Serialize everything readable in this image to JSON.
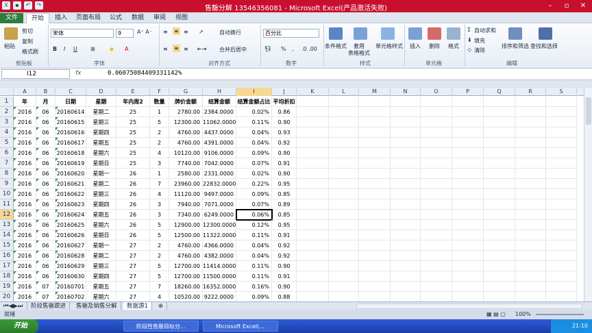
{
  "window": {
    "title": "售罄分解 13546356081 - Microsoft Excel(产品激活失败)"
  },
  "tabs": [
    "文件",
    "开始",
    "插入",
    "页面布局",
    "公式",
    "数据",
    "审阅",
    "视图"
  ],
  "ribbon": {
    "clipboard": {
      "paste": "粘贴",
      "cut": "剪切",
      "copy": "复制",
      "format_painter": "格式刷",
      "label": "剪贴板"
    },
    "font": {
      "name": "宋体",
      "size": "9",
      "label": "字体"
    },
    "alignment": {
      "wrap": "自动换行",
      "merge": "合并后居中",
      "label": "对齐方式"
    },
    "number": {
      "format": "百分比",
      "label": "数字"
    },
    "styles": {
      "conditional": "条件格式",
      "table": "套用\n表格格式",
      "cell": "单元格样式",
      "label": "样式"
    },
    "cells": {
      "insert": "插入",
      "delete": "删除",
      "format": "格式",
      "label": "单元格"
    },
    "editing": {
      "autosum": "自动求和",
      "fill": "填充",
      "clear": "清除",
      "sort": "排序和筛选",
      "find": "查找和选择",
      "label": "编辑"
    }
  },
  "formula_bar": {
    "name_box": "I12",
    "fx": "fx",
    "value": "0.06075084409331142%"
  },
  "columns": [
    "A",
    "B",
    "C",
    "D",
    "E",
    "F",
    "G",
    "H",
    "I",
    "J",
    "K",
    "L",
    "M",
    "N",
    "O",
    "P",
    "Q",
    "R",
    "S"
  ],
  "headers": [
    "年",
    "月",
    "日期",
    "星期",
    "年内周2",
    "数量",
    "牌价金额",
    "结算金额",
    "结算金额占比",
    "平均折扣"
  ],
  "rows": [
    [
      "2016",
      "06",
      "20160614",
      "星期二",
      "25",
      "1",
      "2780.00",
      "2384.0000",
      "0.02%",
      "0.86"
    ],
    [
      "2016",
      "06",
      "20160615",
      "星期三",
      "25",
      "5",
      "12300.00",
      "11062.0000",
      "0.11%",
      "0.90"
    ],
    [
      "2016",
      "06",
      "20160616",
      "星期四",
      "25",
      "2",
      "4760.00",
      "4437.0000",
      "0.04%",
      "0.93"
    ],
    [
      "2016",
      "06",
      "20160617",
      "星期五",
      "25",
      "2",
      "4760.00",
      "4391.0000",
      "0.04%",
      "0.92"
    ],
    [
      "2016",
      "06",
      "20160618",
      "星期六",
      "25",
      "4",
      "10120.00",
      "9106.0000",
      "0.09%",
      "0.90"
    ],
    [
      "2016",
      "06",
      "20160619",
      "星期日",
      "25",
      "3",
      "7740.00",
      "7042.0000",
      "0.07%",
      "0.91"
    ],
    [
      "2016",
      "06",
      "20160620",
      "星期一",
      "26",
      "1",
      "2580.00",
      "2331.0000",
      "0.02%",
      "0.90"
    ],
    [
      "2016",
      "06",
      "20160621",
      "星期二",
      "26",
      "7",
      "23960.00",
      "22832.0000",
      "0.22%",
      "0.95"
    ],
    [
      "2016",
      "06",
      "20160622",
      "星期三",
      "26",
      "4",
      "11120.00",
      "9497.0000",
      "0.09%",
      "0.85"
    ],
    [
      "2016",
      "06",
      "20160623",
      "星期四",
      "26",
      "3",
      "7940.00",
      "7071.0000",
      "0.07%",
      "0.89"
    ],
    [
      "2016",
      "06",
      "20160624",
      "星期五",
      "26",
      "3",
      "7340.00",
      "6249.0000",
      "0.06%",
      "0.85"
    ],
    [
      "2016",
      "06",
      "20160625",
      "星期六",
      "26",
      "5",
      "12900.00",
      "12300.0000",
      "0.12%",
      "0.95"
    ],
    [
      "2016",
      "06",
      "20160626",
      "星期日",
      "26",
      "5",
      "12500.00",
      "11322.0000",
      "0.11%",
      "0.91"
    ],
    [
      "2016",
      "06",
      "20160627",
      "星期一",
      "27",
      "2",
      "4760.00",
      "4366.0000",
      "0.04%",
      "0.92"
    ],
    [
      "2016",
      "06",
      "20160628",
      "星期二",
      "27",
      "2",
      "4760.00",
      "4382.0000",
      "0.04%",
      "0.92"
    ],
    [
      "2016",
      "06",
      "20160629",
      "星期三",
      "27",
      "5",
      "12700.00",
      "11414.0000",
      "0.11%",
      "0.90"
    ],
    [
      "2016",
      "06",
      "20160630",
      "星期四",
      "27",
      "5",
      "12700.00",
      "11500.0000",
      "0.11%",
      "0.91"
    ],
    [
      "2016",
      "07",
      "20160701",
      "星期五",
      "27",
      "7",
      "18260.00",
      "16352.0000",
      "0.16%",
      "0.90"
    ],
    [
      "2016",
      "07",
      "20160702",
      "星期六",
      "27",
      "4",
      "10520.00",
      "9222.0000",
      "0.09%",
      "0.88"
    ]
  ],
  "sheets": [
    "阶段售罄跟进",
    "售罄及销售分解",
    "数据源1"
  ],
  "status": {
    "ready": "就绪",
    "zoom": "100%"
  },
  "taskbar": {
    "start": "开始",
    "items": [
      "阶段性售罄目标分...",
      "Microsoft Excel(..."
    ],
    "clock": "21:10"
  }
}
